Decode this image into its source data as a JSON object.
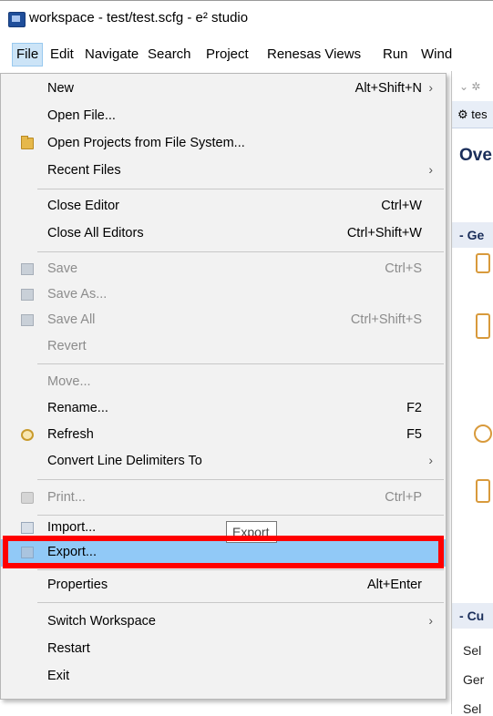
{
  "window": {
    "title": "workspace - test/test.scfg - e² studio"
  },
  "menubar": [
    "File",
    "Edit",
    "Navigate",
    "Search",
    "Project",
    "Renesas Views",
    "Run",
    "Wind"
  ],
  "file_menu": {
    "new": {
      "label": "New",
      "shortcut": "Alt+Shift+N"
    },
    "open_file": {
      "label": "Open File..."
    },
    "open_projects": {
      "label": "Open Projects from File System..."
    },
    "recent_files": {
      "label": "Recent Files"
    },
    "close_editor": {
      "label": "Close Editor",
      "shortcut": "Ctrl+W"
    },
    "close_all_editors": {
      "label": "Close All Editors",
      "shortcut": "Ctrl+Shift+W"
    },
    "save": {
      "label": "Save",
      "shortcut": "Ctrl+S"
    },
    "save_as": {
      "label": "Save As..."
    },
    "save_all": {
      "label": "Save All",
      "shortcut": "Ctrl+Shift+S"
    },
    "revert": {
      "label": "Revert"
    },
    "move": {
      "label": "Move..."
    },
    "rename": {
      "label": "Rename...",
      "shortcut": "F2"
    },
    "refresh": {
      "label": "Refresh",
      "shortcut": "F5"
    },
    "convert_line_delimiters": {
      "label": "Convert Line Delimiters To"
    },
    "print": {
      "label": "Print...",
      "shortcut": "Ctrl+P"
    },
    "import": {
      "label": "Import..."
    },
    "export": {
      "label": "Export..."
    },
    "properties": {
      "label": "Properties",
      "shortcut": "Alt+Enter"
    },
    "switch_workspace": {
      "label": "Switch Workspace"
    },
    "restart": {
      "label": "Restart"
    },
    "exit": {
      "label": "Exit"
    }
  },
  "tooltip": {
    "text": "Export"
  },
  "right_pane": {
    "tab": "tes",
    "header": "Ove",
    "section1": "Ge",
    "section2": "Cu",
    "rows": [
      "Sel",
      "Ger",
      "Sel"
    ]
  }
}
